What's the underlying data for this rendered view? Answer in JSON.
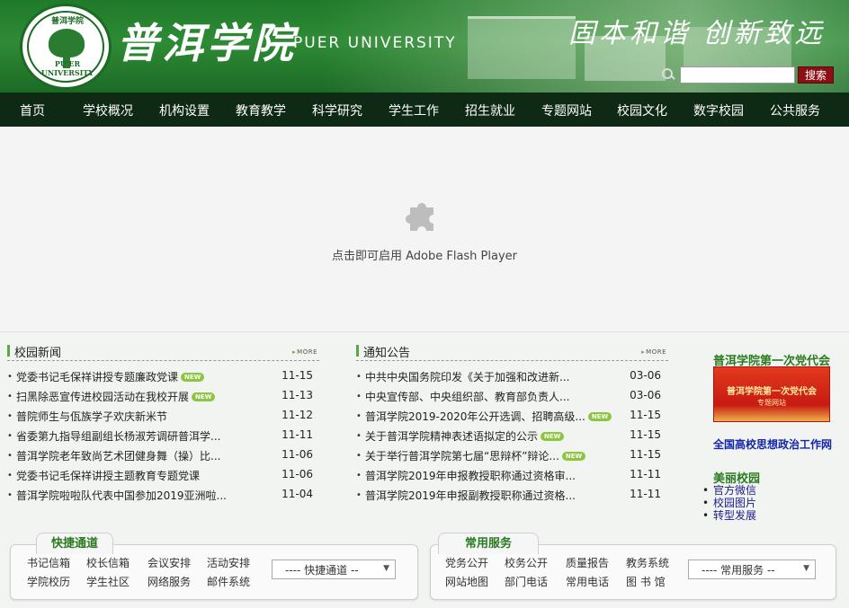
{
  "header": {
    "school_name_cn": "普洱学院",
    "school_name_en": "PUER UNIVERSITY",
    "motto": "固本和谐  创新致远",
    "logo_top_text": "普洱学院",
    "logo_bottom_text": "PU'ER UNIVERSITY",
    "search_placeholder": "",
    "search_button": "搜索"
  },
  "nav": [
    "首页",
    "学校概况",
    "机构设置",
    "教育教学",
    "科学研究",
    "学生工作",
    "招生就业",
    "专题网站",
    "校园文化",
    "数字校园",
    "公共服务"
  ],
  "flash": {
    "message": "点击即可启用 Adobe Flash Player",
    "icon": "puzzle-icon"
  },
  "news": {
    "title": "校园新闻",
    "more": "MORE",
    "items": [
      {
        "title": "党委书记毛保祥讲授专题廉政党课",
        "new": true,
        "date": "11-15"
      },
      {
        "title": "扫黑除恶宣传进校园活动在我校开展",
        "new": true,
        "date": "11-13"
      },
      {
        "title": "普院师生与佤族学子欢庆新米节",
        "new": false,
        "date": "11-12"
      },
      {
        "title": "省委第九指导组副组长杨淑芳调研普洱学...",
        "new": false,
        "date": "11-11"
      },
      {
        "title": "普洱学院老年致尚艺术团健身舞（操）比...",
        "new": false,
        "date": "11-06"
      },
      {
        "title": "党委书记毛保祥讲授主题教育专题党课",
        "new": false,
        "date": "11-06"
      },
      {
        "title": "普洱学院啦啦队代表中国参加2019亚洲啦...",
        "new": false,
        "date": "11-04"
      }
    ]
  },
  "notices": {
    "title": "通知公告",
    "more": "MORE",
    "items": [
      {
        "title": "中共中央国务院印发《关于加强和改进新...",
        "new": false,
        "date": "03-06"
      },
      {
        "title": "中央宣传部、中央组织部、教育部负责人...",
        "new": false,
        "date": "03-06"
      },
      {
        "title": "普洱学院2019-2020年公开选调、招聘高级...",
        "new": true,
        "date": "11-15"
      },
      {
        "title": "关于普洱学院精神表述语拟定的公示",
        "new": true,
        "date": "11-15"
      },
      {
        "title": "关于举行普洱学院第七届“思辩杯”辩论...",
        "new": true,
        "date": "11-15"
      },
      {
        "title": "普洱学院2019年申报教授职称通过资格审...",
        "new": false,
        "date": "11-11"
      },
      {
        "title": "普洱学院2019年申报副教授职称通过资格...",
        "new": false,
        "date": "11-11"
      }
    ]
  },
  "right": {
    "congress_title": "普洱学院第一次党代会",
    "banner_title": "普洱学院第一次党代会",
    "banner_sub": "专题网站",
    "link": "全国高校思想政治工作网",
    "campus_title": "美丽校园",
    "campus_items": [
      "官方微信",
      "校园图片",
      "转型发展"
    ]
  },
  "quick": {
    "title": "快捷通道",
    "links": [
      "书记信箱",
      "校长信箱",
      "会议安排",
      "活动安排",
      "学院校历",
      "学生社区",
      "网络服务",
      "邮件系统"
    ],
    "select": "----  快捷通道  --"
  },
  "services": {
    "title": "常用服务",
    "links": [
      "党务公开",
      "校务公开",
      "质量报告",
      "教务系统",
      "网站地图",
      "部门电话",
      "常用电话",
      "图 书 馆"
    ],
    "select": "----  常用服务  --"
  },
  "colors": {
    "header_green": "#1f7a2a",
    "nav_bg": "#0e2a14",
    "search_button": "#8b0f14",
    "section_green": "#2a7a1f",
    "new_badge": "#8cc63f",
    "link_blue": "#1326a8"
  }
}
